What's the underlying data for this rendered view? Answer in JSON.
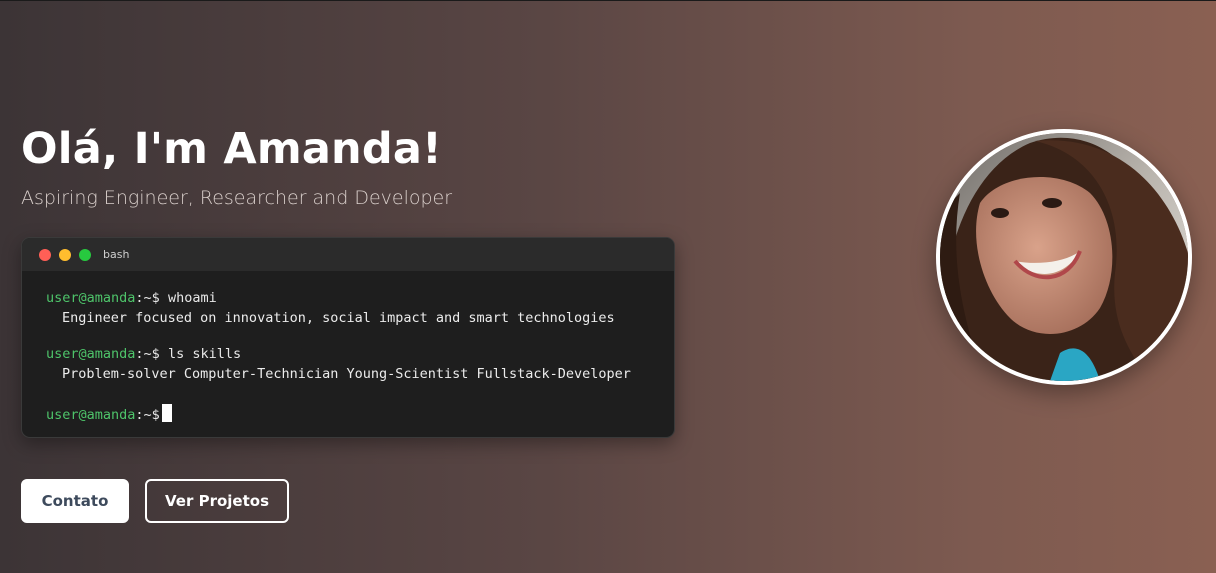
{
  "hero": {
    "title": "Olá, I'm Amanda!",
    "subtitle": "Aspiring Engineer, Researcher and Developer"
  },
  "terminal": {
    "title": "bash",
    "prompt_user": "user@amanda",
    "prompt_sym": ":~$",
    "commands": [
      {
        "cmd": "whoami",
        "output": "Engineer focused on innovation, social impact and smart technologies"
      },
      {
        "cmd": "ls skills",
        "output": "Problem-solver Computer-Technician Young-Scientist Fullstack-Developer"
      }
    ]
  },
  "buttons": {
    "contact": "Contato",
    "projects": "Ver Projetos"
  },
  "colors": {
    "prompt_green": "#4ec46a",
    "contact_text": "#3d4a5c"
  }
}
